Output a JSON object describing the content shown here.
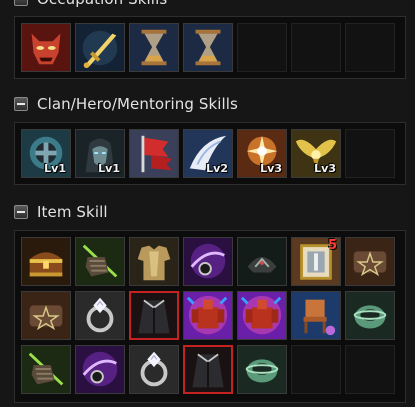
{
  "sections": {
    "occupation": {
      "title": "Occupation Skills"
    },
    "clan": {
      "title": "Clan/Hero/Mentoring Skills",
      "levels": [
        "Lv1",
        "Lv1",
        "",
        "Lv2",
        "Lv3",
        "Lv3"
      ]
    },
    "item": {
      "title": "Item Skill",
      "badge": "5"
    }
  },
  "icons": {
    "occupation": [
      "red-demon-face-icon",
      "golden-sword-icon",
      "hourglass-icon",
      "hourglass-icon"
    ],
    "clan": [
      "iron-cross-shield-icon",
      "hooded-hero-icon",
      "red-banner-icon",
      "white-comet-icon",
      "golden-burst-icon",
      "golden-wings-icon"
    ],
    "item_row1": [
      "treasure-chest-icon",
      "green-gauntlet-icon",
      "golden-armor-icon",
      "purple-amulet-icon",
      "dark-helmet-icon",
      "scroll-book-icon",
      "pentagram-bracelet-icon"
    ],
    "item_row2": [
      "pentagram-bracelet-icon",
      "diamond-ring-icon",
      "dark-cloak-icon",
      "red-golem-icon",
      "red-golem-icon",
      "wooden-chair-icon",
      "jade-bracelet-icon"
    ],
    "item_row3": [
      "green-gauntlet-icon",
      "purple-amulet-icon",
      "diamond-ring-icon",
      "dark-cloak-icon",
      "jade-bracelet-icon"
    ]
  }
}
